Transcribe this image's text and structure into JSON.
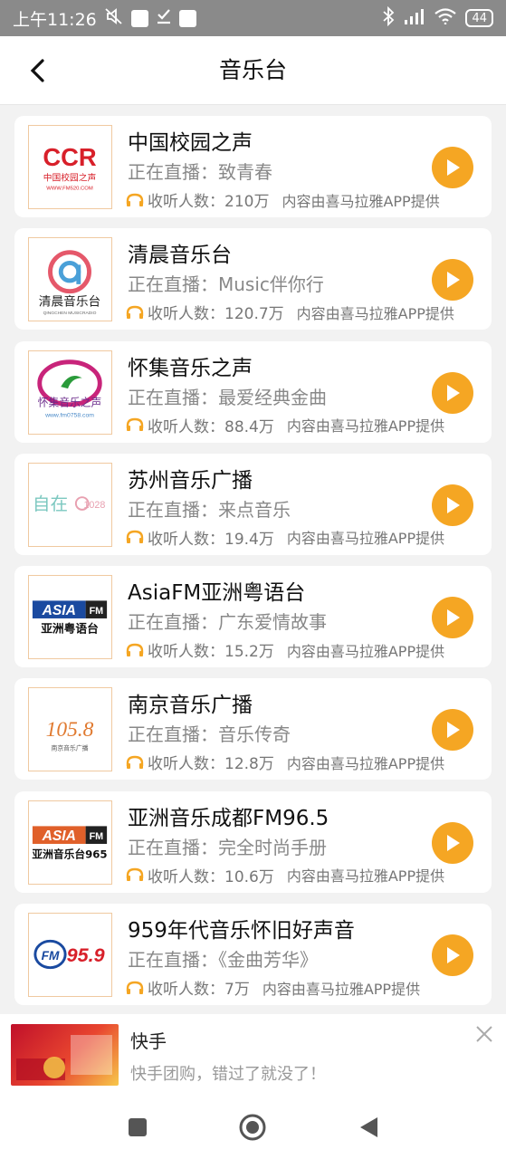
{
  "status_bar": {
    "time": "上午11:26",
    "battery": "44"
  },
  "header": {
    "title": "音乐台"
  },
  "stations": [
    {
      "name": "中国校园之声",
      "live": "正在直播：致青春",
      "listeners": "收听人数：210万",
      "source": "内容由喜马拉雅APP提供",
      "logo_text": "CCR",
      "logo_sub": "中国校园之声",
      "logo_url": "WWW.FM520.COM"
    },
    {
      "name": "清晨音乐台",
      "live": "正在直播：Music伴你行",
      "listeners": "收听人数：120.7万",
      "source": "内容由喜马拉雅APP提供",
      "logo_text": "清晨音乐台",
      "logo_sub": "QINGCHEN MUSICRADIO"
    },
    {
      "name": "怀集音乐之声",
      "live": "正在直播：最爱经典金曲",
      "listeners": "收听人数：88.4万",
      "source": "内容由喜马拉雅APP提供",
      "logo_text": "怀集音乐之声",
      "logo_url": "www.fm0758.com"
    },
    {
      "name": "苏州音乐广播",
      "live": "正在直播：来点音乐",
      "listeners": "收听人数：19.4万",
      "source": "内容由喜马拉雅APP提供",
      "logo_text": "自在",
      "logo_sub": "1028"
    },
    {
      "name": "AsiaFM亚洲粤语台",
      "live": "正在直播：广东爱情故事",
      "listeners": "收听人数：15.2万",
      "source": "内容由喜马拉雅APP提供",
      "logo_text": "ASIA",
      "logo_fm": "FM",
      "logo_sub": "亚洲粤语台"
    },
    {
      "name": "南京音乐广播",
      "live": "正在直播：音乐传奇",
      "listeners": "收听人数：12.8万",
      "source": "内容由喜马拉雅APP提供",
      "logo_text": "105.8",
      "logo_sub": "南京音乐广播"
    },
    {
      "name": "亚洲音乐成都FM96.5",
      "live": "正在直播：完全时尚手册",
      "listeners": "收听人数：10.6万",
      "source": "内容由喜马拉雅APP提供",
      "logo_text": "ASIA",
      "logo_fm": "FM",
      "logo_sub": "亚洲音乐台965"
    },
    {
      "name": "959年代音乐怀旧好声音",
      "live": "正在直播：《金曲芳华》",
      "listeners": "收听人数：7万",
      "source": "内容由喜马拉雅APP提供",
      "logo_text": "FM",
      "logo_sub": "95.9"
    }
  ],
  "ad": {
    "title": "快手",
    "description": "快手团购，错过了就没了！"
  },
  "colors": {
    "accent": "#f5a623",
    "status_bar": "#8a8a8a"
  }
}
